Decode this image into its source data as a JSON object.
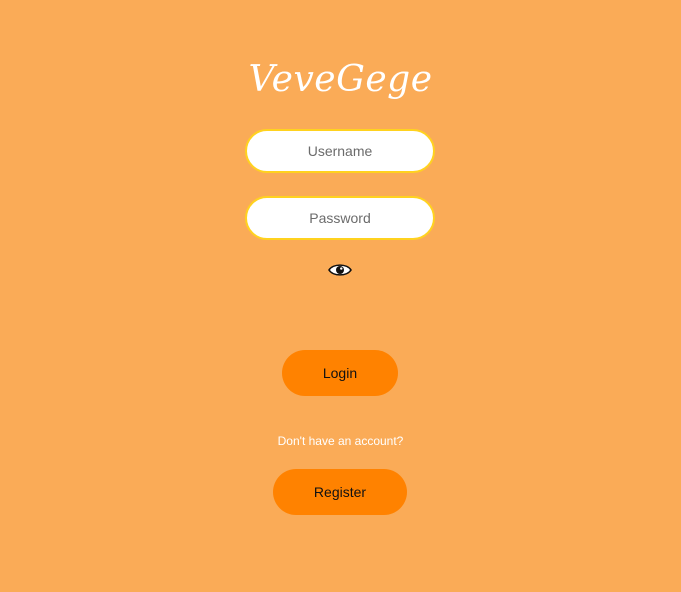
{
  "brand": {
    "logo_text": "VeveGege"
  },
  "login_form": {
    "username_placeholder": "Username",
    "username_value": "",
    "password_placeholder": "Password",
    "password_value": "",
    "toggle_visibility_icon": "eye-icon",
    "login_label": "Login"
  },
  "signup": {
    "prompt": "Don't have an account?",
    "register_label": "Register"
  },
  "colors": {
    "background": "#FAAB57",
    "button": "#FF8200",
    "input_border": "#FFD21F",
    "text_light": "#FFFFFF"
  }
}
